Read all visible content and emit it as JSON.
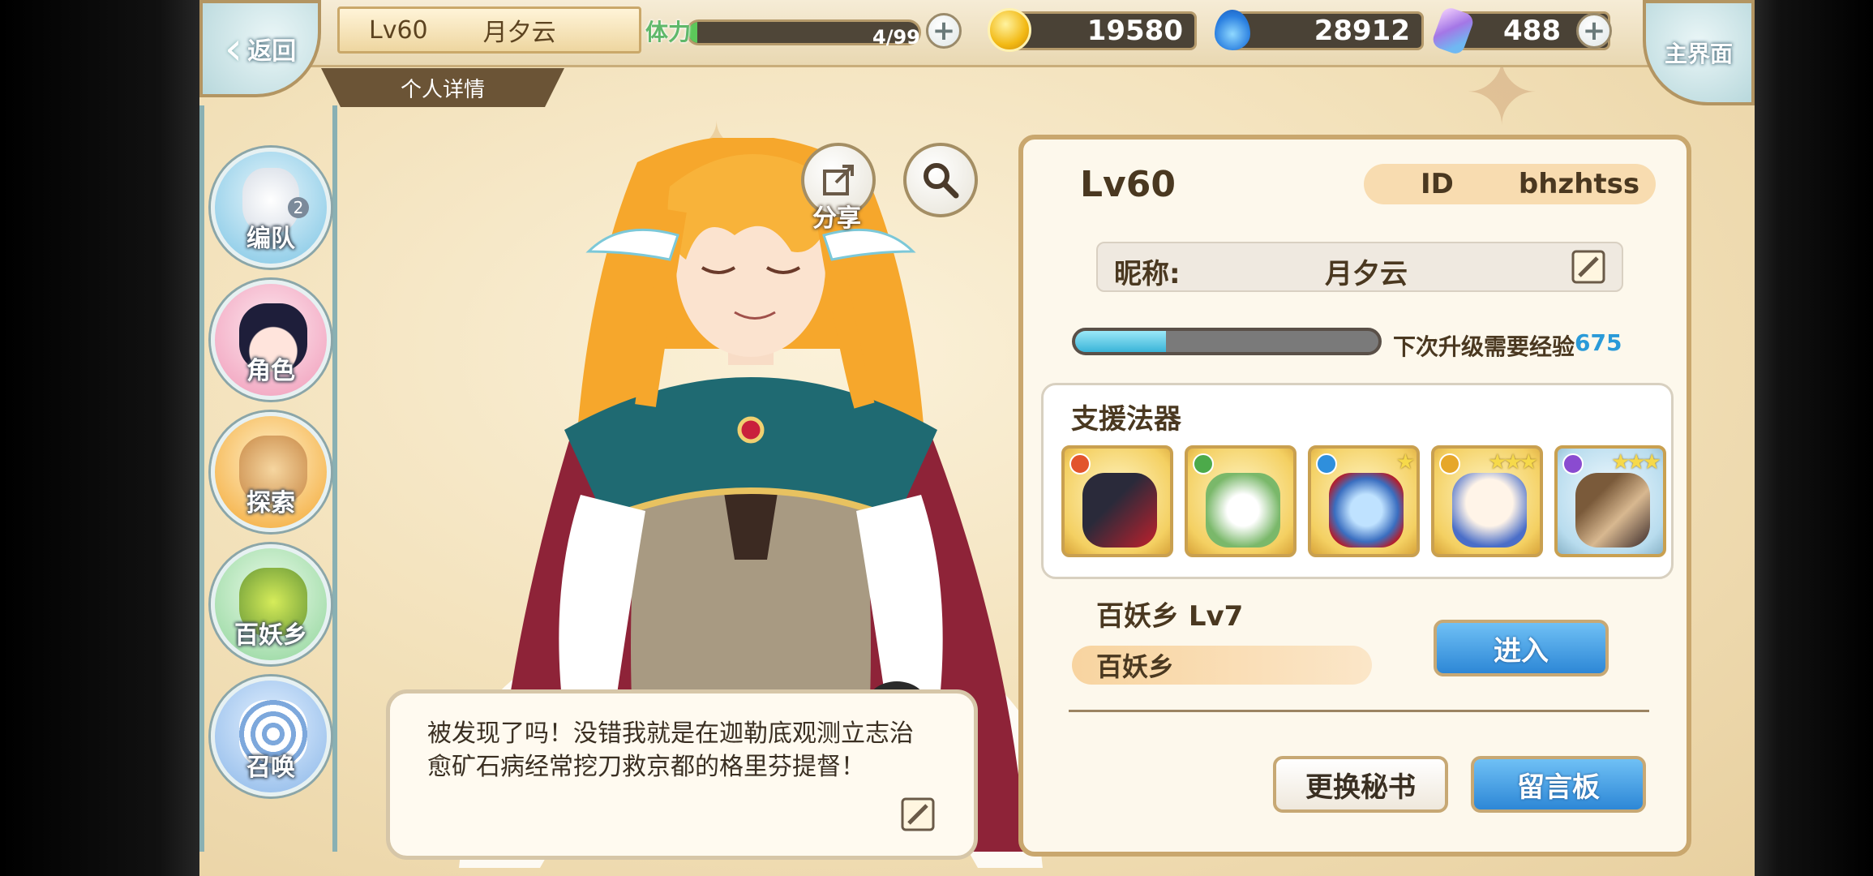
{
  "top_bar": {
    "back_label": "返回",
    "level": "Lv60",
    "player_name": "月夕云",
    "sub_tab": "个人详情",
    "stamina_label": "体力",
    "stamina_value": "4/99",
    "stamina_fraction": 0.04,
    "gold": "19580",
    "soul": "28912",
    "gems": "488",
    "home_label": "主界面"
  },
  "side_nav": [
    {
      "label": "编队",
      "badge": "2"
    },
    {
      "label": "角色"
    },
    {
      "label": "探索"
    },
    {
      "label": "百妖乡"
    },
    {
      "label": "召唤"
    }
  ],
  "share_label": "分享",
  "speech": {
    "text": "被发现了吗！没错我就是在迦勒底观测立志治愈矿石病经常挖刀救京都的格里芬提督！"
  },
  "panel": {
    "level": "Lv60",
    "id_label": "ID",
    "id_value": "bhzhtss",
    "nickname_label": "昵称:",
    "nickname_value": "月夕云",
    "exp_fraction": 0.3,
    "exp_text": "下次升级需要经验",
    "exp_value": "675",
    "support_title": "支援法器",
    "support_items": [
      {
        "name": "fan-item",
        "element_color": "#e2542c",
        "stars": ""
      },
      {
        "name": "bell-orchid-item",
        "element_color": "#4caa4a",
        "stars": ""
      },
      {
        "name": "fox-plate-item",
        "element_color": "#2f8fdc",
        "stars": "★"
      },
      {
        "name": "snow-globe-item",
        "element_color": "#e6a72a",
        "stars": "★★★"
      },
      {
        "name": "fish-fan-item",
        "element_color": "#8a4bd0",
        "stars": "★★★"
      }
    ],
    "village_title": "百妖乡  Lv7",
    "village_name": "百妖乡",
    "enter_button": "进入",
    "change_secretary_button": "更换秘书",
    "message_board_button": "留言板"
  },
  "colors": {
    "accent_gold": "#c9a76e",
    "blue_button": "#2d87d6",
    "exp_blue": "#2a9ad8"
  }
}
